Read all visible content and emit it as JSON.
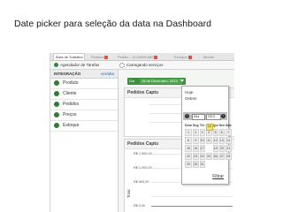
{
  "slide": {
    "title": "Date picker para seleção da data na Dashboard"
  },
  "tabs": [
    {
      "label": "Área de Trabalho",
      "active": true
    },
    {
      "label": "Pedidos"
    },
    {
      "label": "Pedido - 10.00896.886"
    },
    {
      "label": "Estoque"
    },
    {
      "label": "Tarefas"
    }
  ],
  "toolbar": {
    "agendador": "Agendador de Tarefas",
    "carregando": "Carregando serviços"
  },
  "sidebar": {
    "header": "INTEGRAÇÃO",
    "header_link": "ver/aba",
    "items": [
      {
        "label": "Produto"
      },
      {
        "label": "Cliente"
      },
      {
        "label": "Pedidos"
      },
      {
        "label": "Preços"
      },
      {
        "label": "Estoque"
      }
    ]
  },
  "datebar": {
    "label": "Dia",
    "value": "18 de Dezembro, 2013"
  },
  "panels": {
    "p1_title": "Pedidos Captu",
    "p2_title": "Pedidos Captu"
  },
  "chart": {
    "ylabel": "Total",
    "ticks": [
      "R$ 1.500,00",
      "R$ 1.000,00",
      "R$ 500,00",
      "R$ 0,00"
    ]
  },
  "popup": {
    "options": [
      "Hoje",
      "Ontem"
    ],
    "month": "Dez",
    "year": "2013",
    "weekdays": [
      "Dom",
      "Seg",
      "Ter",
      "Qua",
      "Qui",
      "Sex",
      "Sáb"
    ],
    "weeks": [
      [
        "1",
        "2",
        "3",
        "4",
        "5",
        "6",
        "7"
      ],
      [
        "8",
        "9",
        "10",
        "11",
        "12",
        "13",
        "14"
      ],
      [
        "15",
        "16",
        "17",
        "18",
        "19",
        "20",
        "21"
      ],
      [
        "22",
        "23",
        "24",
        "25",
        "26",
        "27",
        "28"
      ],
      [
        "29",
        "30",
        "31",
        "",
        "",
        "",
        ""
      ]
    ],
    "selected_day": "18",
    "filter": "Filtrar"
  },
  "colors": {
    "accent_green": "#3f8f3f",
    "selected_day": "#f5e06a"
  }
}
